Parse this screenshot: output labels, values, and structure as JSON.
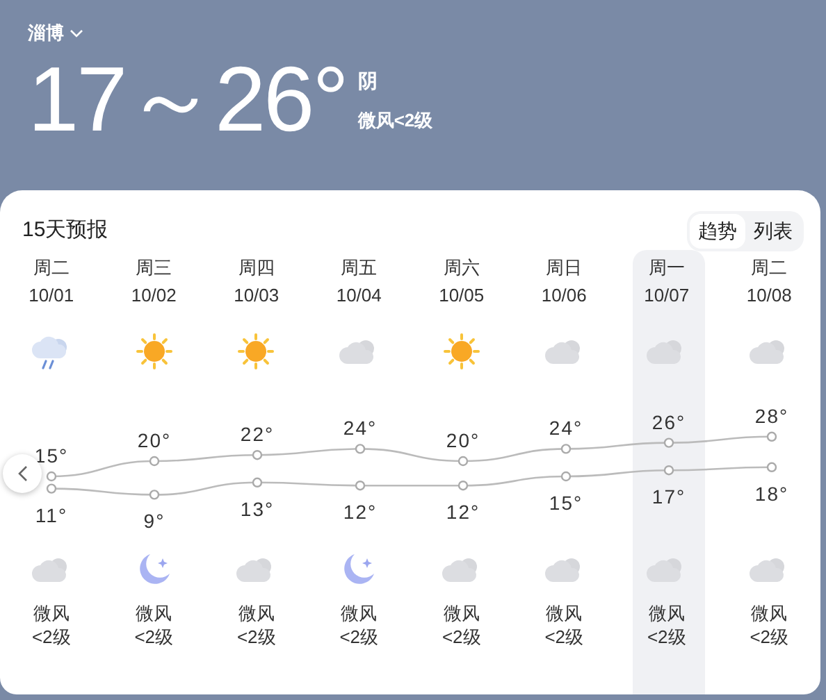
{
  "header": {
    "city": "淄博",
    "temperature": "17～26°",
    "condition": "阴",
    "wind": "微风<2级"
  },
  "forecast": {
    "title": "15天预报",
    "view_tabs": [
      {
        "label": "趋势",
        "selected": true
      },
      {
        "label": "列表",
        "selected": false
      }
    ],
    "days": [
      {
        "weekday": "周二",
        "date": "10/01",
        "day_icon": {
          "kind": "rain"
        },
        "night_icon": {
          "kind": "cloud"
        },
        "wind": "微风",
        "wind_level": "<2级",
        "selected": false
      },
      {
        "weekday": "周三",
        "date": "10/02",
        "day_icon": {
          "kind": "sun"
        },
        "night_icon": {
          "kind": "moon"
        },
        "wind": "微风",
        "wind_level": "<2级",
        "selected": false
      },
      {
        "weekday": "周四",
        "date": "10/03",
        "day_icon": {
          "kind": "sun"
        },
        "night_icon": {
          "kind": "cloud"
        },
        "wind": "微风",
        "wind_level": "<2级",
        "selected": false
      },
      {
        "weekday": "周五",
        "date": "10/04",
        "day_icon": {
          "kind": "cloud"
        },
        "night_icon": {
          "kind": "moon"
        },
        "wind": "微风",
        "wind_level": "<2级",
        "selected": false
      },
      {
        "weekday": "周六",
        "date": "10/05",
        "day_icon": {
          "kind": "sun"
        },
        "night_icon": {
          "kind": "cloud"
        },
        "wind": "微风",
        "wind_level": "<2级",
        "selected": false
      },
      {
        "weekday": "周日",
        "date": "10/06",
        "day_icon": {
          "kind": "cloud"
        },
        "night_icon": {
          "kind": "cloud"
        },
        "wind": "微风",
        "wind_level": "<2级",
        "selected": false
      },
      {
        "weekday": "周一",
        "date": "10/07",
        "day_icon": {
          "kind": "cloud"
        },
        "night_icon": {
          "kind": "cloud"
        },
        "wind": "微风",
        "wind_level": "<2级",
        "selected": true
      },
      {
        "weekday": "周二",
        "date": "10/08",
        "day_icon": {
          "kind": "cloud"
        },
        "night_icon": {
          "kind": "cloud"
        },
        "wind": "微风",
        "wind_level": "<2级",
        "selected": false
      }
    ],
    "chart_data": {
      "type": "line",
      "series": [
        {
          "color": "#bbbbbb",
          "marker": true,
          "values": [
            15,
            20,
            22,
            24,
            20,
            24,
            26,
            28
          ],
          "value_labels": [
            "15°",
            "20°",
            "22°",
            "24°",
            "20°",
            "24°",
            "26°",
            "28°"
          ]
        },
        {
          "color": "#bbbbbb",
          "marker": true,
          "values": [
            11,
            9,
            13,
            12,
            12,
            15,
            17,
            18
          ],
          "value_labels": [
            "11°",
            "9°",
            "13°",
            "12°",
            "12°",
            "15°",
            "17°",
            "18°"
          ]
        }
      ]
    }
  }
}
